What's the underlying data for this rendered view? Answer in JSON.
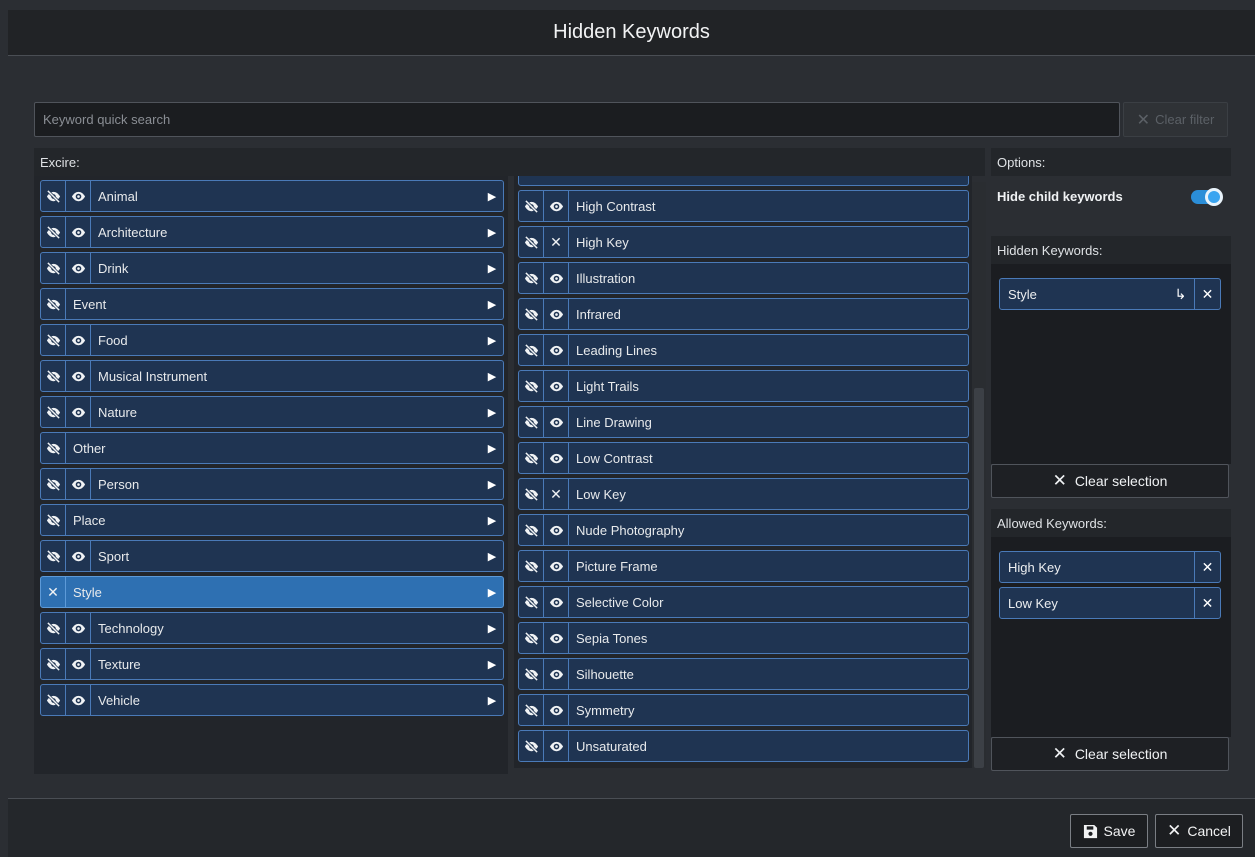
{
  "window": {
    "title": "Hidden Keywords"
  },
  "search": {
    "placeholder": "Keyword quick search",
    "value": "",
    "clear_filter_label": "Clear filter"
  },
  "left_panel": {
    "header": "Excire:",
    "items": [
      {
        "label": "Animal",
        "toggle": "eye",
        "has_children": true
      },
      {
        "label": "Architecture",
        "toggle": "eye",
        "has_children": true
      },
      {
        "label": "Drink",
        "toggle": "eye",
        "has_children": true
      },
      {
        "label": "Event",
        "toggle": null,
        "has_children": true
      },
      {
        "label": "Food",
        "toggle": "eye",
        "has_children": true
      },
      {
        "label": "Musical Instrument",
        "toggle": "eye",
        "has_children": true
      },
      {
        "label": "Nature",
        "toggle": "eye",
        "has_children": true
      },
      {
        "label": "Other",
        "toggle": null,
        "has_children": true
      },
      {
        "label": "Person",
        "toggle": "eye",
        "has_children": true
      },
      {
        "label": "Place",
        "toggle": null,
        "has_children": true
      },
      {
        "label": "Sport",
        "toggle": "eye",
        "has_children": true
      },
      {
        "label": "Style",
        "toggle": null,
        "has_children": true,
        "selected": true
      },
      {
        "label": "Technology",
        "toggle": "eye",
        "has_children": true
      },
      {
        "label": "Texture",
        "toggle": "eye",
        "has_children": true
      },
      {
        "label": "Vehicle",
        "toggle": "eye",
        "has_children": true
      }
    ]
  },
  "middle_panel": {
    "items": [
      {
        "label": "High Contrast",
        "state": "eye"
      },
      {
        "label": "High Key",
        "state": "x"
      },
      {
        "label": "Illustration",
        "state": "eye"
      },
      {
        "label": "Infrared",
        "state": "eye"
      },
      {
        "label": "Leading Lines",
        "state": "eye"
      },
      {
        "label": "Light Trails",
        "state": "eye"
      },
      {
        "label": "Line Drawing",
        "state": "eye"
      },
      {
        "label": "Low Contrast",
        "state": "eye"
      },
      {
        "label": "Low Key",
        "state": "x"
      },
      {
        "label": "Nude Photography",
        "state": "eye"
      },
      {
        "label": "Picture Frame",
        "state": "eye"
      },
      {
        "label": "Selective Color",
        "state": "eye"
      },
      {
        "label": "Sepia Tones",
        "state": "eye"
      },
      {
        "label": "Silhouette",
        "state": "eye"
      },
      {
        "label": "Symmetry",
        "state": "eye"
      },
      {
        "label": "Unsaturated",
        "state": "eye"
      }
    ]
  },
  "options": {
    "header": "Options:",
    "hide_child_keywords_label": "Hide child keywords",
    "hide_child_keywords_on": true,
    "hidden_keywords_header": "Hidden Keywords:",
    "hidden_keywords": [
      "Style"
    ],
    "allowed_keywords_header": "Allowed Keywords:",
    "allowed_keywords": [
      "High Key",
      "Low Key"
    ],
    "clear_selection_label": "Clear selection"
  },
  "footer": {
    "save_label": "Save",
    "cancel_label": "Cancel"
  },
  "colors": {
    "accent": "#2e70b2",
    "row_bg": "#1f3452",
    "row_border": "#4a7ab8",
    "toggle_on": "#2b8ed8"
  }
}
